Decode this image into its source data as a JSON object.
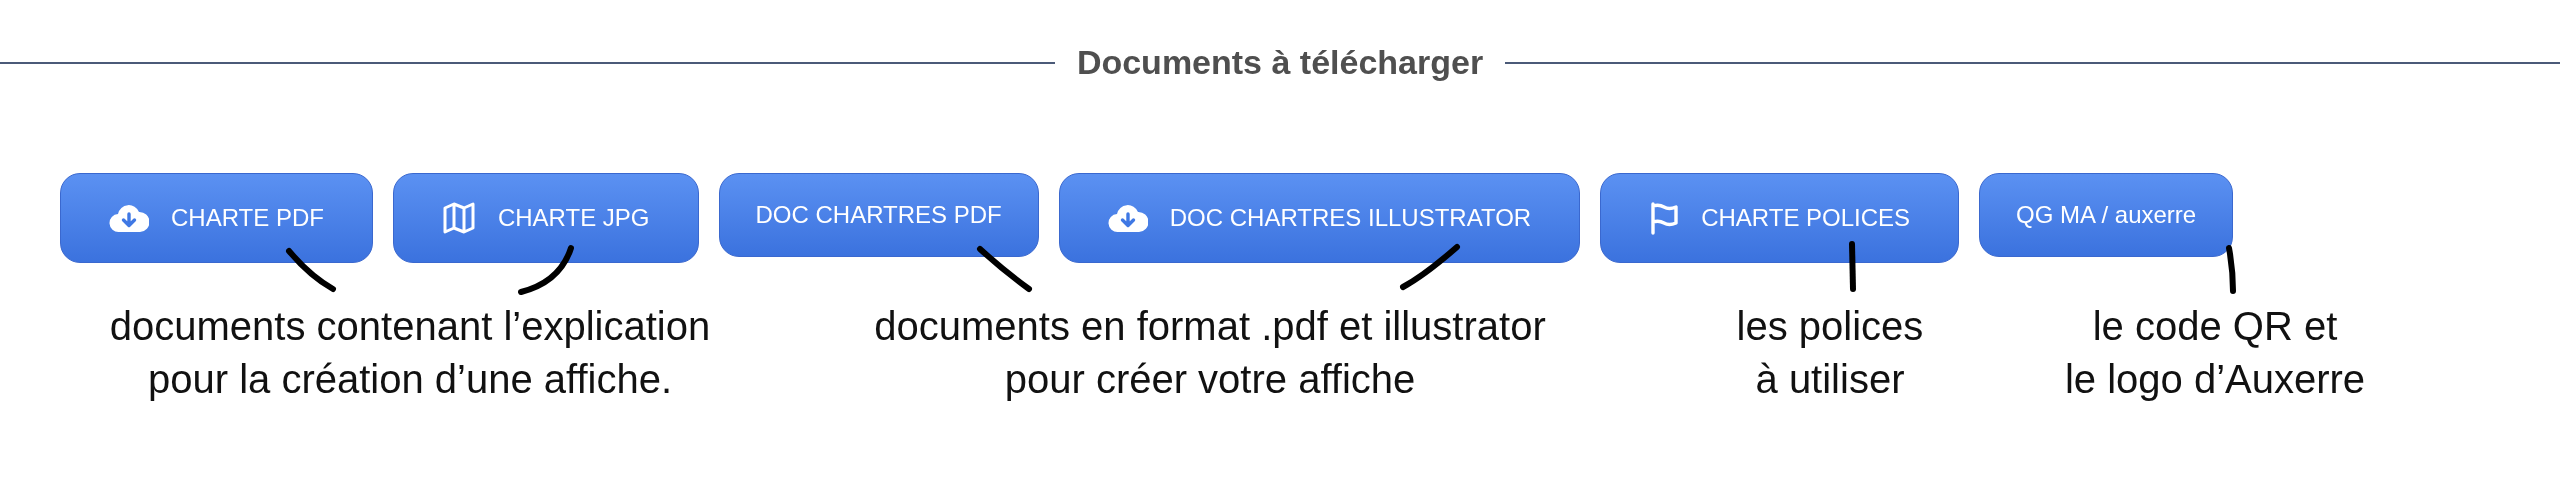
{
  "heading": "Documents à télécharger",
  "buttons": [
    {
      "label": "CHARTE PDF",
      "kind": "download"
    },
    {
      "label": "CHARTE JPG",
      "kind": "map"
    },
    {
      "label": "DOC CHARTRES PDF",
      "kind": "plain"
    },
    {
      "label": "DOC CHARTRES ILLUSTRATOR",
      "kind": "download"
    },
    {
      "label": "CHARTE POLICES",
      "kind": "flag"
    },
    {
      "label": "QG MA / auxerre",
      "kind": "plain"
    }
  ],
  "annotations": [
    {
      "text": "documents contenant l’explication\npour la création d’une affiche."
    },
    {
      "text": "documents en format .pdf et illustrator\npour créer votre affiche"
    },
    {
      "text": "les polices\nà utiliser"
    },
    {
      "text": "le code QR et\nle logo d’Auxerre"
    }
  ]
}
